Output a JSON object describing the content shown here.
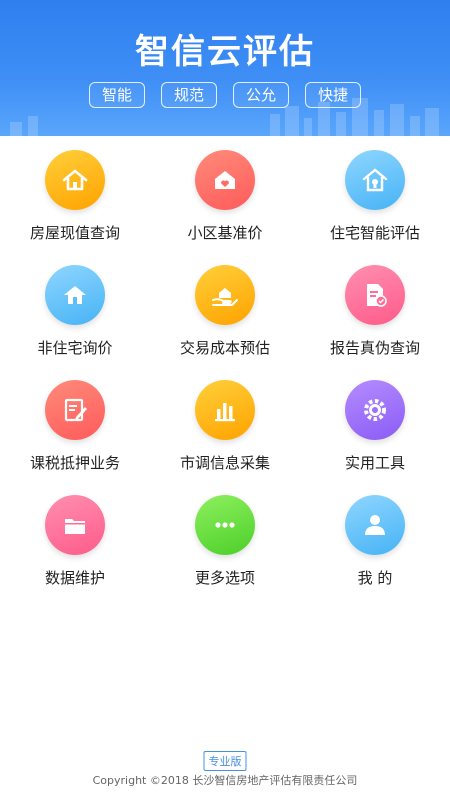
{
  "header": {
    "title": "智信云评估",
    "tags": [
      "智能",
      "规范",
      "公允",
      "快捷"
    ]
  },
  "menu": [
    {
      "label": "房屋现值查询",
      "icon": "house-icon",
      "color_from": "#ffcf3a",
      "color_to": "#ffa300"
    },
    {
      "label": "小区基准价",
      "icon": "house-heart-icon",
      "color_from": "#ff8a7a",
      "color_to": "#ff5b5b"
    },
    {
      "label": "住宅智能评估",
      "icon": "smart-house-icon",
      "color_from": "#8fd6ff",
      "color_to": "#46b3f5"
    },
    {
      "label": "非住宅询价",
      "icon": "home-icon",
      "color_from": "#8fd6ff",
      "color_to": "#46b3f5"
    },
    {
      "label": "交易成本预估",
      "icon": "hand-house-icon",
      "color_from": "#ffcf3a",
      "color_to": "#ffa300"
    },
    {
      "label": "报告真伪查询",
      "icon": "document-check-icon",
      "color_from": "#ff8fb0",
      "color_to": "#ff5b8a"
    },
    {
      "label": "课税抵押业务",
      "icon": "edit-document-icon",
      "color_from": "#ff8a7a",
      "color_to": "#ff5b5b"
    },
    {
      "label": "市调信息采集",
      "icon": "bar-chart-icon",
      "color_from": "#ffcf3a",
      "color_to": "#ffa300"
    },
    {
      "label": "实用工具",
      "icon": "gear-icon",
      "color_from": "#b58cff",
      "color_to": "#8a5cf5"
    },
    {
      "label": "数据维护",
      "icon": "folder-icon",
      "color_from": "#ff8fb0",
      "color_to": "#ff5b8a"
    },
    {
      "label": "更多选项",
      "icon": "more-dots-icon",
      "color_from": "#8ef05e",
      "color_to": "#4ccf2a"
    },
    {
      "label": "我 的",
      "icon": "user-icon",
      "color_from": "#8fd6ff",
      "color_to": "#46b3f5"
    }
  ],
  "footer": {
    "badge": "专业版",
    "copyright": "Copyright ©2018 长沙智信房地产评估有限责任公司"
  }
}
